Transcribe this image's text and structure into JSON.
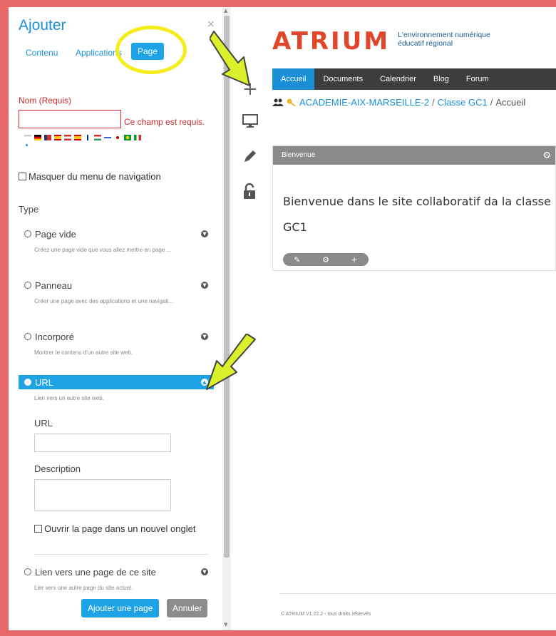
{
  "panel": {
    "title": "Ajouter",
    "close": "×",
    "tabs": [
      {
        "label": "Contenu"
      },
      {
        "label": "Applications"
      },
      {
        "label": "Page"
      }
    ],
    "name_label": "Nom (Requis)",
    "name_value": "",
    "name_error": "Ce champ est requis.",
    "hide_nav_label": "Masquer du menu de navigation",
    "type_label": "Type",
    "options": [
      {
        "label": "Page vide",
        "desc": "Créez une page vide que vous allez mettre en page ...",
        "selected": false
      },
      {
        "label": "Panneau",
        "desc": "Créer une page avec des applications et une navigati...",
        "selected": false
      },
      {
        "label": "Incorporé",
        "desc": "Montrer le contenu d'un autre site web.",
        "selected": false
      },
      {
        "label": "URL",
        "desc": "Lien vers un autre site web.",
        "selected": true
      },
      {
        "label": "Lien vers une page de ce site",
        "desc": "Lier vers une autre page du site actuel.",
        "selected": false
      }
    ],
    "url_label": "URL",
    "url_value": "",
    "description_label": "Description",
    "description_value": "",
    "new_tab_label": "Ouvrir la page dans un nouvel onglet",
    "add_button": "Ajouter une page",
    "cancel_button": "Annuler"
  },
  "toolbar": {
    "add_icon": "+",
    "display_icon": "monitor-icon",
    "edit_icon": "pencil-icon",
    "lock_icon": "unlock-icon"
  },
  "site": {
    "logo": "ATRIUM",
    "tagline_line1": "L'environnement numérique",
    "tagline_line2": "éducatif régional",
    "nav": [
      {
        "label": "Accueil",
        "active": true
      },
      {
        "label": "Documents",
        "active": false
      },
      {
        "label": "Calendrier",
        "active": false
      },
      {
        "label": "Blog",
        "active": false
      },
      {
        "label": "Forum",
        "active": false
      }
    ],
    "breadcrumb": {
      "root": "ACADEMIE-AIX-MARSEILLE-2",
      "middle": "Classe GC1",
      "current": "Accueil",
      "separator": "/"
    },
    "widget": {
      "title": "Bienvenue",
      "text": "Bienvenue dans le site collaboratif da la classe GC1"
    },
    "footer": "© ATRIUM V1.22.2 - tous droits réservés"
  },
  "colors": {
    "accent": "#1ea4e6",
    "error": "#cc2b2b",
    "logo": "#e2462a",
    "annotation": "#f5ec1a",
    "arrow": "#d9f02a",
    "background": "#e9696a"
  }
}
